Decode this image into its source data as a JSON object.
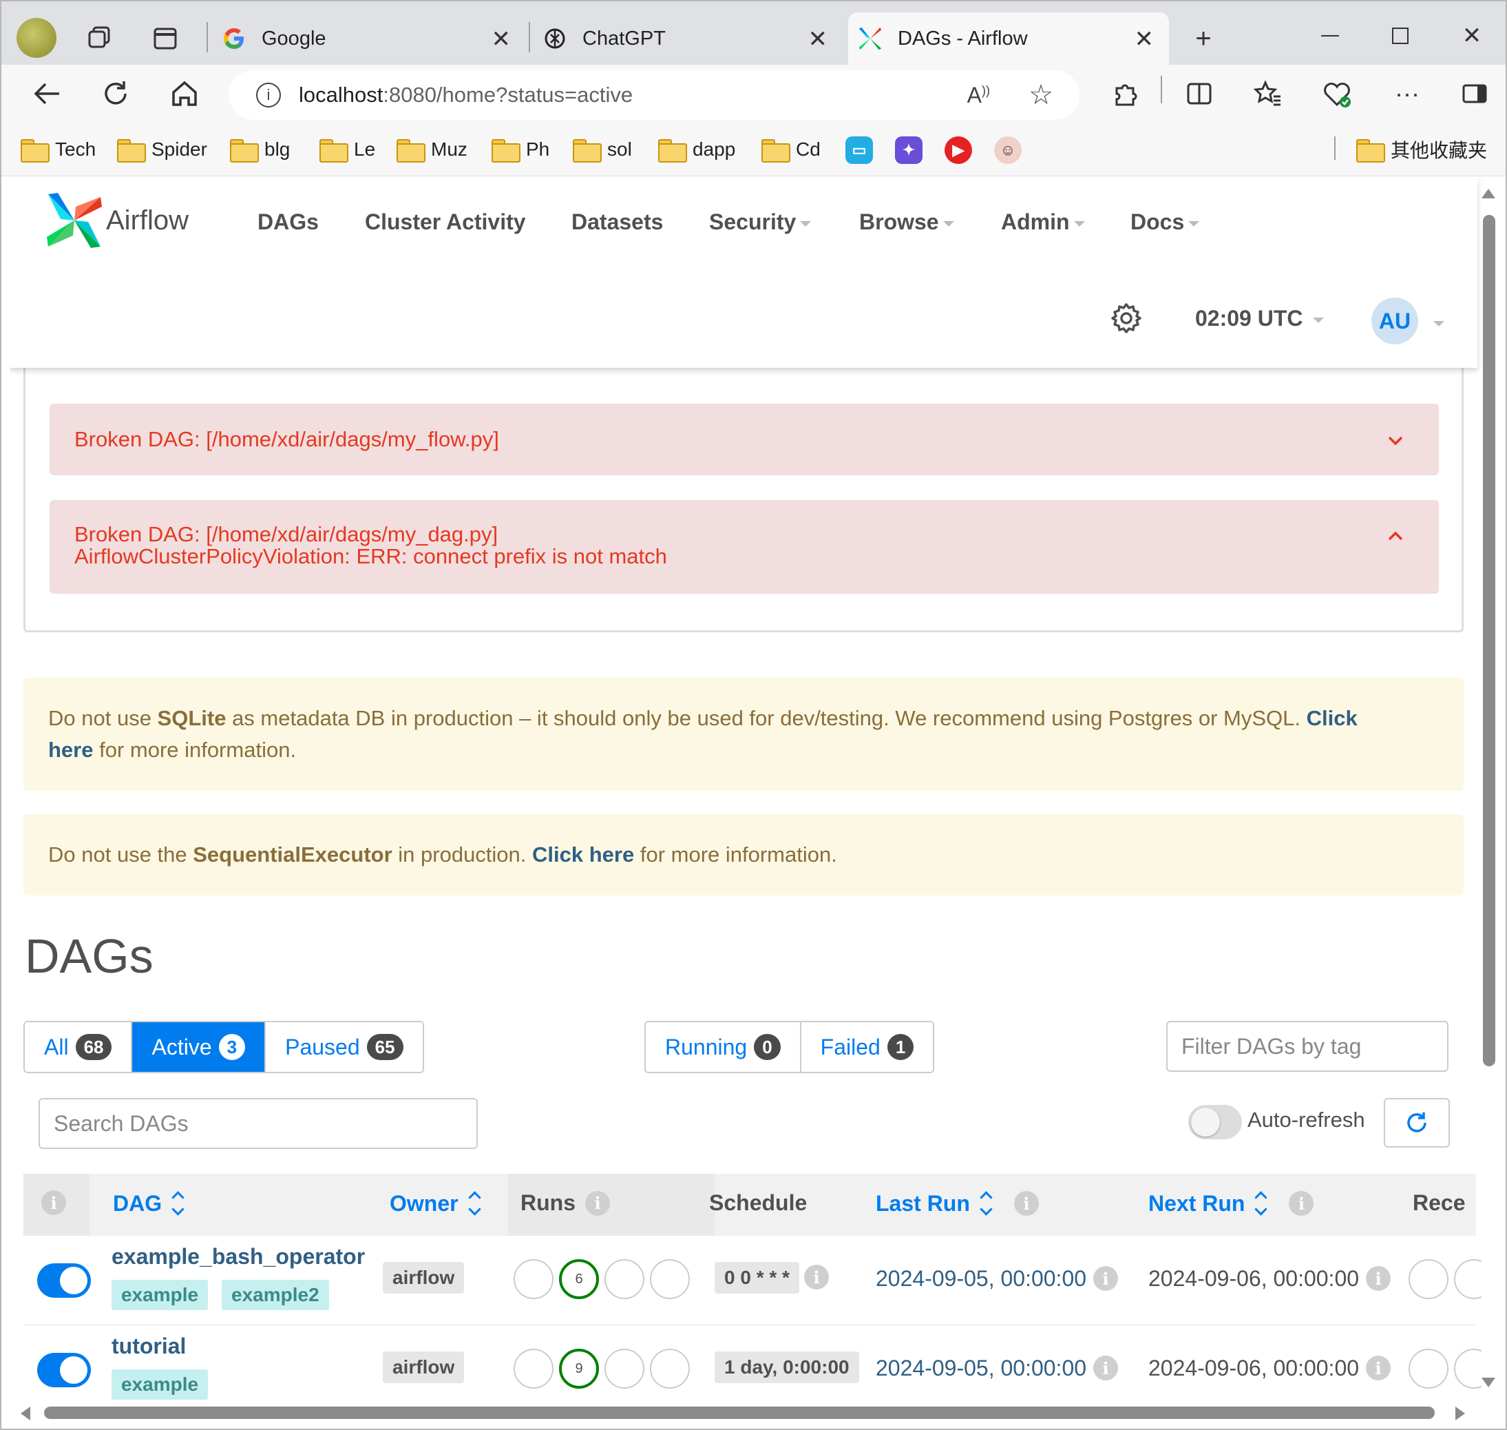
{
  "browser": {
    "tabs": [
      {
        "title": "Google"
      },
      {
        "title": "ChatGPT"
      },
      {
        "title": "DAGs - Airflow"
      }
    ],
    "address": {
      "host": "localhost",
      "path": ":8080/home?status=active"
    },
    "bookmarks": [
      "Tech",
      "Spider",
      "blg",
      "Le",
      "Muz",
      "Ph",
      "sol",
      "dapp",
      "Cd"
    ],
    "other_bookmarks": "其他收藏夹"
  },
  "navbar": {
    "brand": "Airflow",
    "menu": {
      "dags": "DAGs",
      "cluster": "Cluster Activity",
      "datasets": "Datasets",
      "security": "Security",
      "browse": "Browse",
      "admin": "Admin",
      "docs": "Docs"
    },
    "time": "02:09 UTC",
    "avatar": "AU"
  },
  "errors": [
    {
      "line1": "Broken DAG: [/home/xd/air/dags/my_flow.py]"
    },
    {
      "line1": "Broken DAG: [/home/xd/air/dags/my_dag.py]",
      "line2": "AirflowClusterPolicyViolation: ERR: connect prefix is not match"
    }
  ],
  "warnings": {
    "sqlite": {
      "pre": "Do not use ",
      "bold": "SQLite",
      "mid": " as metadata DB in production – it should only be used for dev/testing. We recommend using Postgres or MySQL. ",
      "link1": "Click",
      "link2": "here",
      "post": " for more information."
    },
    "executor": {
      "pre": "Do not use the ",
      "bold": "SequentialExecutor",
      "mid": " in production. ",
      "link": "Click here",
      "post": " for more information."
    }
  },
  "page_title": "DAGs",
  "filters": {
    "all": {
      "label": "All",
      "count": "68"
    },
    "active": {
      "label": "Active",
      "count": "3"
    },
    "paused": {
      "label": "Paused",
      "count": "65"
    },
    "running": {
      "label": "Running",
      "count": "0"
    },
    "failed": {
      "label": "Failed",
      "count": "1"
    },
    "tag_placeholder": "Filter DAGs by tag",
    "search_placeholder": "Search DAGs",
    "auto_refresh": "Auto-refresh"
  },
  "table": {
    "headers": {
      "dag": "DAG",
      "owner": "Owner",
      "runs": "Runs",
      "schedule": "Schedule",
      "last_run": "Last Run",
      "next_run": "Next Run",
      "recent": "Rece"
    },
    "rows": [
      {
        "name": "example_bash_operator",
        "tags": [
          "example",
          "example2"
        ],
        "owner": "airflow",
        "runs_success": "6",
        "schedule": "0 0 * * *",
        "last_run": "2024-09-05, 00:00:00",
        "next_run": "2024-09-06, 00:00:00"
      },
      {
        "name": "tutorial",
        "tags": [
          "example"
        ],
        "owner": "airflow",
        "runs_success": "9",
        "schedule": "1 day, 0:00:00",
        "last_run": "2024-09-05, 00:00:00",
        "next_run": "2024-09-06, 00:00:00"
      }
    ]
  }
}
